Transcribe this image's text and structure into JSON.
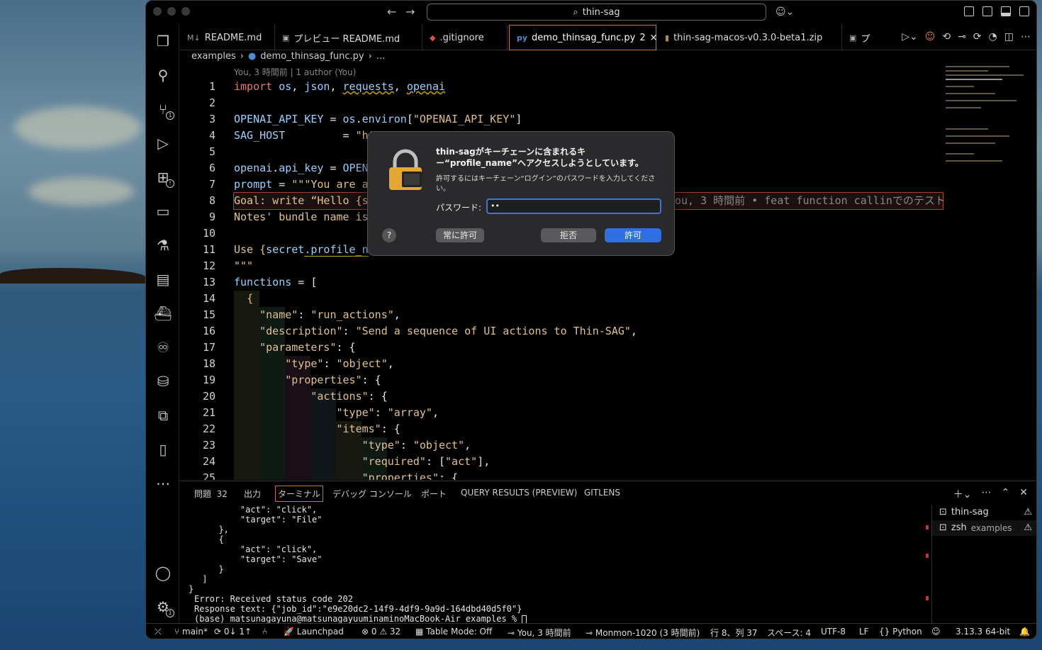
{
  "titlebar": {
    "search": "thin-sag"
  },
  "tabs": [
    {
      "label": "README.md",
      "icon": "M↓"
    },
    {
      "label": "プレビュー README.md",
      "icon": "▣"
    },
    {
      "label": ".gitignore",
      "icon": "◆"
    },
    {
      "label": "demo_thinsag_func.py",
      "count": "2",
      "icon": "py"
    },
    {
      "label": "thin-sag-macos-v0.3.0-beta1.zip",
      "icon": "▮"
    },
    {
      "label": "プ",
      "icon": "▣"
    }
  ],
  "breadcrumb": {
    "folder": "examples",
    "file": "demo_thinsag_func.py",
    "more": "..."
  },
  "codelens": "You, 3 時間前 | 1 author (You)",
  "line_numbers": [
    "1",
    "2",
    "3",
    "4",
    "5",
    "6",
    "7",
    "8",
    "9",
    "10",
    "11",
    "12",
    "13",
    "14",
    "15",
    "16",
    "17",
    "18",
    "19",
    "20",
    "21",
    "22",
    "23",
    "24",
    "25"
  ],
  "code": {
    "l1": {
      "kw": "import",
      "a": "os",
      "b": "json",
      "c": "requests",
      "d": "openai"
    },
    "l3": {
      "name": "OPENAI_API_KEY",
      "os": "os",
      "environ": "environ",
      "key": "\"OPENAI_API_KEY\""
    },
    "l4": {
      "name": "SAG_HOST",
      "val": "\"ht"
    },
    "l6": {
      "a": "openai",
      "b": "api_key",
      "c": "OPEN"
    },
    "l7": {
      "a": "prompt",
      "b": "\"\"\"You are a"
    },
    "l8": {
      "text": "Goal: write “Hello {s",
      "blame": "ou, 3 時間前 • feat function callinでのテスト"
    },
    "l9": "Notes' bundle name is",
    "l11": {
      "a": "Use {",
      "b": "secret",
      "c": ".profile_n"
    },
    "l12": "\"\"\"",
    "l13": {
      "a": "functions",
      "b": " = ["
    },
    "l14": "{",
    "l15": {
      "k": "\"name\"",
      "v": "\"run_actions\""
    },
    "l16": {
      "k": "\"description\"",
      "v1": "\"Send a sequence of UI actions to Thin",
      "v2": "-SAG\""
    },
    "l17": {
      "k": "\"parameters\""
    },
    "l18": {
      "k": "\"type\"",
      "v": "\"object\""
    },
    "l19": {
      "k": "\"properties\""
    },
    "l20": {
      "k": "\"actions\""
    },
    "l21": {
      "k": "\"type\"",
      "v": "\"array\""
    },
    "l22": {
      "k": "\"items\""
    },
    "l23": {
      "k": "\"type\"",
      "v": "\"object\""
    },
    "l24": {
      "k": "\"required\"",
      "v": "\"act\""
    },
    "l25": {
      "k": "\"properties\""
    }
  },
  "panel": {
    "tabs": [
      "問題",
      "出力",
      "ターミナル",
      "デバッグ コンソール",
      "ポート",
      "QUERY RESULTS (PREVIEW)",
      "GITLENS"
    ],
    "problems_count": "32"
  },
  "terminal_lines": [
    "    \"act\": \"click\",",
    "    \"target\": \"File\"",
    "  },",
    "  {",
    "    \"act\": \"click\",",
    "    \"target\": \"Save\"",
    "  }",
    " ]",
    "}",
    "Error: Received status code 202",
    "Response text: {\"job_id\":\"e9e20dc2-14f9-4df9-9a9d-164dbd40d5f0\"}",
    "(base) matsunagayuna@matsunagayuuminaminoMacBook-Air examples % "
  ],
  "terminals": [
    {
      "name": "thin-sag",
      "sub": ""
    },
    {
      "name": "zsh",
      "sub": "examples"
    }
  ],
  "statusbar": {
    "branch": "main*",
    "sync": "0↓ 1↑",
    "launchpad": "Launchpad",
    "errors": "0",
    "warnings": "32",
    "table_mode": "Table Mode: Off",
    "blame": "You, 3 時間前",
    "commit": "Monmon-1020 (3 時間前)",
    "position": "行 8、列 37",
    "spaces": "スペース: 4",
    "encoding": "UTF-8",
    "eol": "LF",
    "language": "Python",
    "interpreter": "3.13.3 64-bit"
  },
  "dialog": {
    "title": "thin-sagがキーチェーンに含まれるキー“profile_name”へアクセスしようとしています。",
    "message": "許可するにはキーチェーン“ログイン”のパスワードを入力してください。",
    "password_label": "パスワード:",
    "password_value": "••",
    "always_allow": "常に許可",
    "deny": "拒否",
    "allow": "許可",
    "help": "?"
  }
}
